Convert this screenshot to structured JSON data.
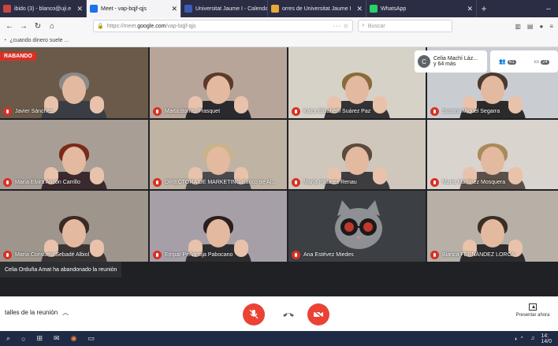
{
  "browser": {
    "tabs": [
      {
        "label": "ibido (3) - blanco@uji.e",
        "close": "✕",
        "active": false,
        "icon_color": "#c44",
        "width": 110
      },
      {
        "label": "Meet - vap-bqjf-qjs",
        "close": "✕",
        "active": true,
        "icon_color": "#1a73e8",
        "width": 120
      },
      {
        "label": "Universitat Jaume I - Calendar",
        "close": "✕",
        "active": false,
        "icon_color": "#3b5bb5",
        "width": 110
      },
      {
        "label": "orres de Universitat Jaume I",
        "close": "✕",
        "active": false,
        "icon_color": "#e8a93a",
        "width": 125
      },
      {
        "label": "WhatsApp",
        "close": "✕",
        "active": false,
        "icon_color": "#25d366",
        "width": 140
      }
    ],
    "url_prefix": "https://meet.",
    "url_domain": "google.com",
    "url_path": "/vap-bqjf-qjs",
    "search_placeholder": "Buscar",
    "bookmark_label": "¿cuando dinero suele ..."
  },
  "meeting": {
    "recording_label": "RABANDO",
    "info_card": {
      "avatar_letter": "C",
      "line1": "Celia Machí Láz...",
      "line2": "y 64 más"
    },
    "participants_count": "61",
    "chat_count": "24",
    "toast": "Celia Orduña Amat ha abandonado la reunión",
    "details_label": "talles de la reunión",
    "present_label": "Presentar ahora"
  },
  "tiles": [
    {
      "name": "Javier Sánchez",
      "bg": "#6b5a4a",
      "body": "#3a3d44",
      "hair": "#8a8a8a",
      "col": 0,
      "row": 0
    },
    {
      "name": "Marta Borràs Frasquet",
      "bg": "#b8a59a",
      "body": "#2a2a2e",
      "hair": "#5c3a2a",
      "col": 1,
      "row": 0
    },
    {
      "name": "Kaira Elizabeth Suárez Paz",
      "bg": "#d6d2c8",
      "body": "#333336",
      "hair": "#8a6a3a",
      "col": 2,
      "row": 0
    },
    {
      "name": "Susana Miquel Segarra",
      "bg": "#c9cdd2",
      "body": "#2b2b2b",
      "hair": "#4a3a30",
      "col": 3,
      "row": 0
    },
    {
      "name": "María Elvira Ancón Carrillo",
      "bg": "#a89e96",
      "body": "#3a2a2e",
      "hair": "#7a2a1a",
      "col": 0,
      "row": 1
    },
    {
      "name": "DIRECTORA DE MARKETING Banco de Al...",
      "bg": "#bfb3a4",
      "body": "#4a4a4f",
      "hair": "#c9b48a",
      "col": 1,
      "row": 1
    },
    {
      "name": "María Pallarés Renau",
      "bg": "#cfc6bc",
      "body": "#3d3d40",
      "hair": "#5a4a3a",
      "col": 2,
      "row": 1
    },
    {
      "name": "María Martínez Mosquera",
      "bg": "#d9d4ce",
      "body": "#5a5048",
      "hair": "#a98a5a",
      "col": 3,
      "row": 1
    },
    {
      "name": "María Consuelo Sebadé Albiol",
      "bg": "#9e958c",
      "body": "#3a3535",
      "hair": "#3a2a22",
      "col": 0,
      "row": 2
    },
    {
      "name": "Empar Peñarroja Pabocano",
      "bg": "#a79fa8",
      "body": "#2d2d30",
      "hair": "#2a1f1c",
      "col": 1,
      "row": 2
    },
    {
      "name": "Ana Estévez Miedes",
      "bg": "#3c3f44",
      "body": "#3c3f44",
      "hair": "#3c3f44",
      "col": 2,
      "row": 2,
      "cat": true
    },
    {
      "name": "Blanca FERNÁNDEZ LORCA",
      "bg": "#b7b0a6",
      "body": "#2c2c2f",
      "hair": "#3a2e26",
      "col": 3,
      "row": 2
    }
  ],
  "taskbar": {
    "time": "14:",
    "date": "14/0"
  }
}
